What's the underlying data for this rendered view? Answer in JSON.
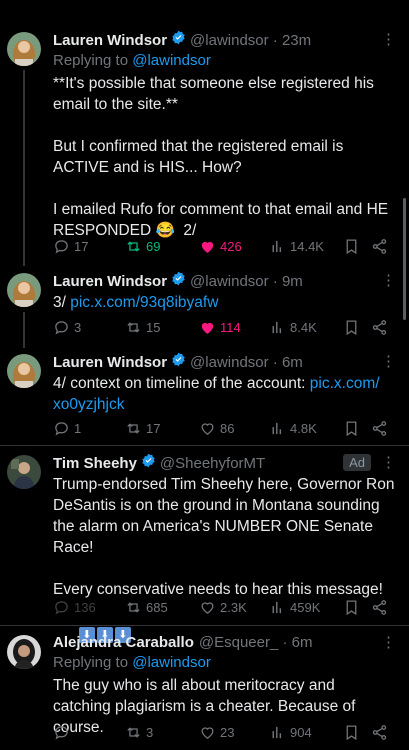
{
  "top_fragment": "· ~ - -",
  "tweets": [
    {
      "name": "Lauren Windsor",
      "handle": "@lawindsor · 23m",
      "replying_prefix": "Replying to ",
      "replying_to": "@lawindsor",
      "text": "**It's possible that someone else registered his email to the site.**\n\nBut I confirmed that the registered email is ACTIVE and is HIS... How?\n\nI emailed Rufo for comment to that email and HE RESPONDED 😂  2/",
      "stats": {
        "replies": "17",
        "retweets": "69",
        "likes": "426",
        "views": "14.4K"
      }
    },
    {
      "name": "Lauren Windsor",
      "handle": "@lawindsor · 9m",
      "text_prefix": "3/ ",
      "link": "pic.x.com/93q8ibyafw",
      "stats": {
        "replies": "3",
        "retweets": "15",
        "likes": "114",
        "views": "8.4K"
      }
    },
    {
      "name": "Lauren Windsor",
      "handle": "@lawindsor · 6m",
      "text_prefix": "4/ context on timeline of the account: ",
      "link_line1": "pic.x.com/",
      "link_line2": "xo0yzjhjck",
      "stats": {
        "replies": "1",
        "retweets": "17",
        "likes": "86",
        "views": "4.8K"
      }
    },
    {
      "name": "Tim Sheehy",
      "handle": "@SheehyforMT",
      "ad_label": "Ad",
      "text": "Trump-endorsed Tim Sheehy here, Governor Ron DeSantis is on the ground in Montana sounding the alarm on America's NUMBER ONE Senate Race!\n\nEvery conservative needs to hear this message!",
      "emoji_arrows": "⬇",
      "stats": {
        "replies": "136",
        "retweets": "685",
        "likes": "2.3K",
        "views": "459K"
      }
    },
    {
      "name": "Alejandra Caraballo",
      "handle": "@Esqueer_ · 6m",
      "replying_prefix": "Replying to ",
      "replying_to": "@lawindsor",
      "text": "The guy who is all about meritocracy and catching plagiarism is a cheater. Because of course.",
      "stats": {
        "replies": "",
        "retweets": "3",
        "likes": "23",
        "views": "904"
      }
    }
  ],
  "colors": {
    "accent": "#1d9bf0",
    "retweet": "#00ba7c",
    "like": "#f91880",
    "muted": "#71767b",
    "verified": "#1d9bf0"
  },
  "icons": [
    "reply-icon",
    "retweet-icon",
    "like-icon",
    "views-icon",
    "bookmark-icon",
    "share-icon",
    "verified-badge-icon",
    "more-icon"
  ]
}
